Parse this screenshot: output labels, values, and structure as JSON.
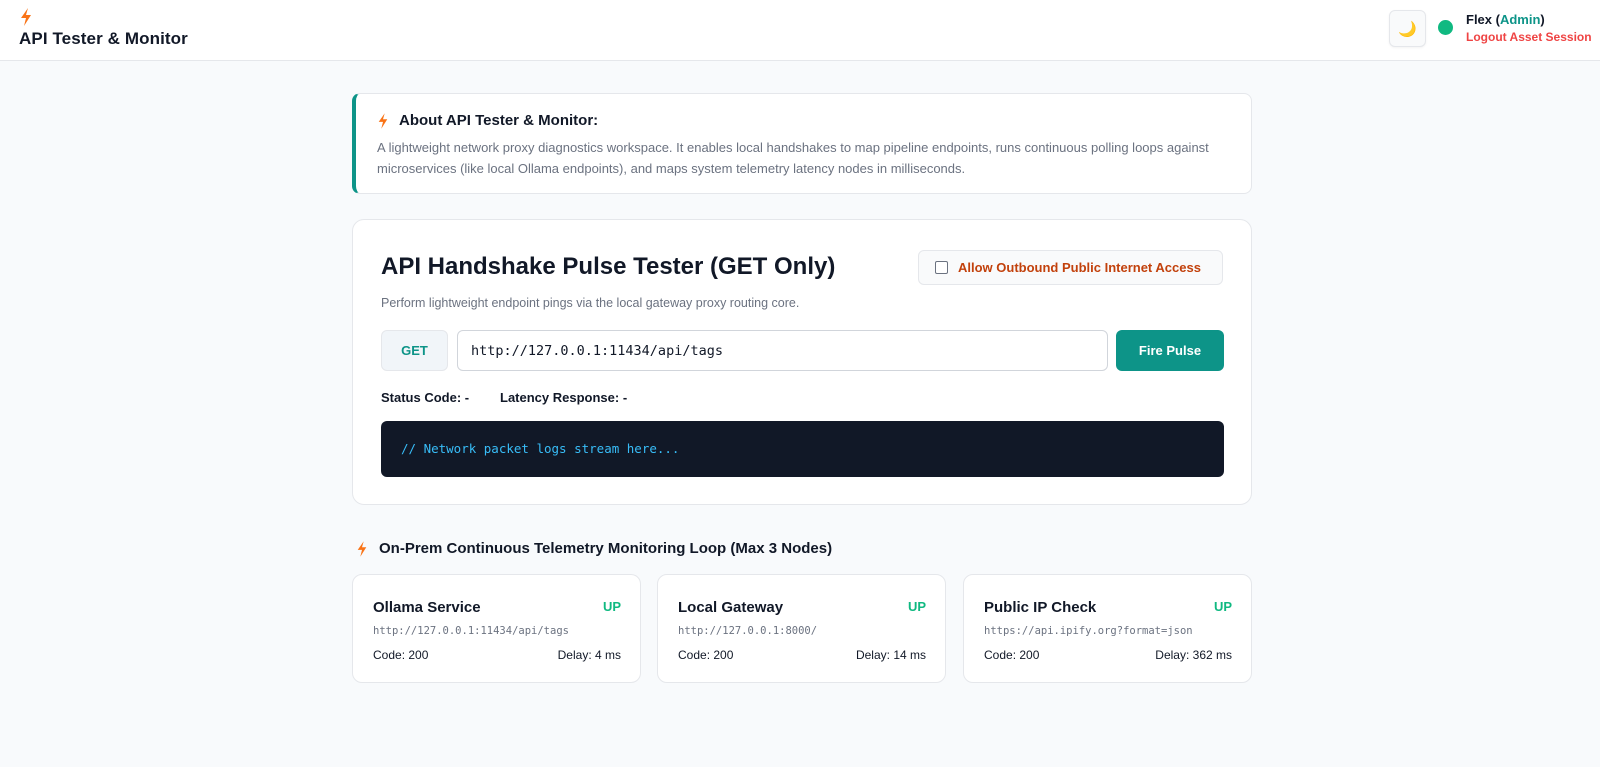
{
  "header": {
    "title": "API Tester & Monitor",
    "theme_icon": "moon-icon",
    "user_name": "Flex",
    "user_role": "Admin",
    "status_color": "#10b981",
    "logout_label": "Logout Asset Session"
  },
  "about": {
    "title": "About API Tester & Monitor:",
    "description": "A lightweight network proxy diagnostics workspace. It enables local handshakes to map pipeline endpoints, runs continuous polling loops against microservices (like local Ollama endpoints), and maps system telemetry latency nodes in milliseconds."
  },
  "tester": {
    "title": "API Handshake Pulse Tester (GET Only)",
    "subtitle": "Perform lightweight endpoint pings via the local gateway proxy routing core.",
    "outbound_label": "Allow Outbound Public Internet Access",
    "outbound_checked": false,
    "method": "GET",
    "url": "http://127.0.0.1:11434/api/tags",
    "fire_label": "Fire Pulse",
    "status_code_label": "Status Code: -",
    "latency_label": "Latency Response: -",
    "console_text": "// Network packet logs stream here..."
  },
  "monitor": {
    "title": "On-Prem Continuous Telemetry Monitoring Loop (Max 3 Nodes)",
    "nodes": [
      {
        "name": "Ollama Service",
        "status": "UP",
        "url": "http://127.0.0.1:11434/api/tags",
        "code": "Code: 200",
        "delay": "Delay: 4 ms"
      },
      {
        "name": "Local Gateway",
        "status": "UP",
        "url": "http://127.0.0.1:8000/",
        "code": "Code: 200",
        "delay": "Delay: 14 ms"
      },
      {
        "name": "Public IP Check",
        "status": "UP",
        "url": "https://api.ipify.org?format=json",
        "code": "Code: 200",
        "delay": "Delay: 362 ms"
      }
    ]
  },
  "colors": {
    "accent": "#0d9488",
    "up": "#10b981",
    "warning_text": "#c2410c",
    "logout": "#ef4444",
    "bolt": "#f97316"
  }
}
